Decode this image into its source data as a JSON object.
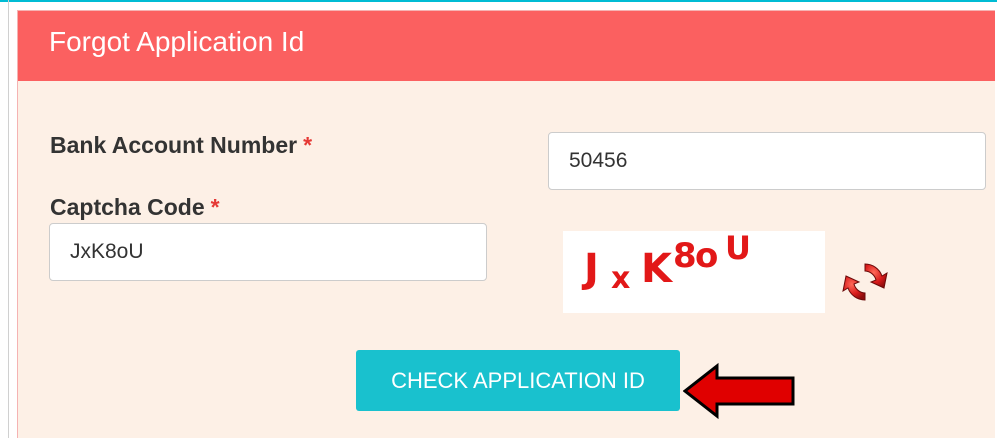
{
  "form": {
    "title": "Forgot Application Id",
    "bank_account": {
      "label": "Bank Account Number",
      "required_mark": "*",
      "value": "50456"
    },
    "captcha": {
      "label": "Captcha Code",
      "required_mark": "*",
      "value": "JxK8oU",
      "image_chars": [
        "J",
        "x",
        "K",
        "8",
        "o",
        "U"
      ]
    },
    "submit_label": "CHECK APPLICATION ID"
  },
  "icons": {
    "refresh": "refresh-icon",
    "pointer": "arrow-left-icon"
  },
  "colors": {
    "header": "#fb6060",
    "panel_bg": "#fdf0e6",
    "button": "#19c1ce",
    "required": "#e53935",
    "captcha_text": "#e21818",
    "arrow": "#e00000"
  }
}
